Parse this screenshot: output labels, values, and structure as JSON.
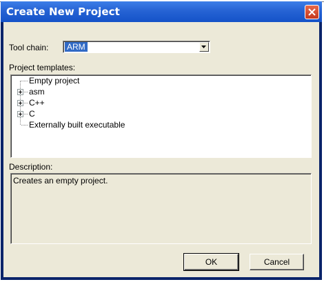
{
  "dialog": {
    "title": "Create New Project",
    "close_icon": "close-icon"
  },
  "toolchain": {
    "label": "Tool chain:",
    "value": "ARM"
  },
  "templates": {
    "label": "Project templates:",
    "items": [
      {
        "label": "Empty project",
        "expandable": false
      },
      {
        "label": "asm",
        "expandable": true
      },
      {
        "label": "C++",
        "expandable": true
      },
      {
        "label": "C",
        "expandable": true
      },
      {
        "label": "Externally built executable",
        "expandable": false
      }
    ]
  },
  "description": {
    "label": "Description:",
    "text": "Creates an empty project."
  },
  "buttons": {
    "ok": "OK",
    "cancel": "Cancel"
  }
}
